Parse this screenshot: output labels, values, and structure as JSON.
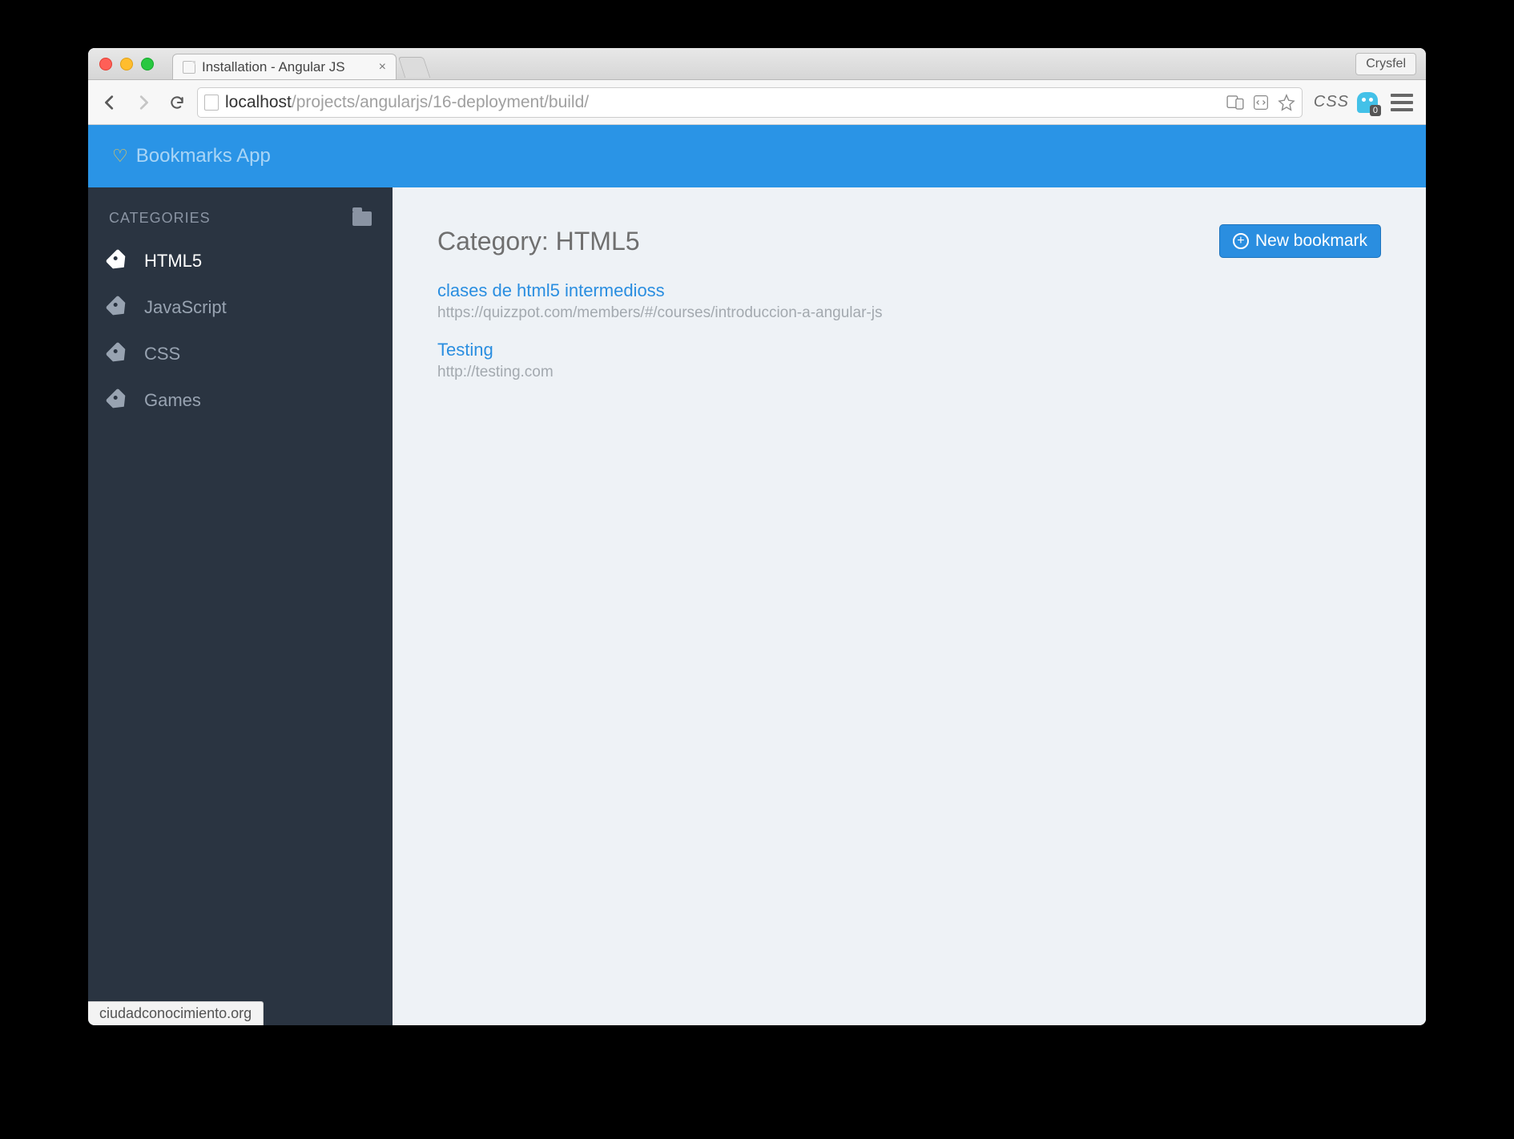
{
  "browser": {
    "tab_title": "Installation - Angular JS",
    "profile_name": "Crysfel",
    "url_host": "localhost",
    "url_path": "/projects/angularjs/16-deployment/build/",
    "ghost_badge": "0",
    "css_ext_label": "CSS",
    "status_text": "ciudadconocimiento.org"
  },
  "header": {
    "brand": "Bookmarks App"
  },
  "sidebar": {
    "heading": "CATEGORIES",
    "items": [
      {
        "label": "HTML5",
        "active": true
      },
      {
        "label": "JavaScript",
        "active": false
      },
      {
        "label": "CSS",
        "active": false
      },
      {
        "label": "Games",
        "active": false
      }
    ]
  },
  "main": {
    "title": "Category: HTML5",
    "new_bookmark_label": "New bookmark",
    "bookmarks": [
      {
        "title": "clases de html5 intermedioss",
        "url": "https://quizzpot.com/members/#/courses/introduccion-a-angular-js"
      },
      {
        "title": "Testing",
        "url": "http://testing.com"
      }
    ]
  }
}
